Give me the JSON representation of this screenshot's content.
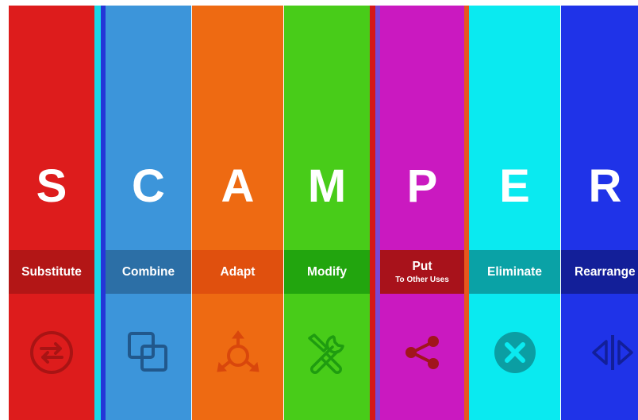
{
  "columns": [
    {
      "letter": "S",
      "word": "Substitute",
      "sub": "",
      "icon": "swap-arrows-icon",
      "bg": "#dd1c1c",
      "band": "#b31616",
      "icon_color": "#a81414"
    },
    {
      "letter": "C",
      "word": "Combine",
      "sub": "",
      "icon": "overlapping-squares-icon",
      "bg": "#3c95da",
      "band": "#2c6fa6",
      "icon_color": "#21588c"
    },
    {
      "letter": "A",
      "word": "Adapt",
      "sub": "",
      "icon": "adapt-arrows-icon",
      "bg": "#ee6a12",
      "band": "#e0500e",
      "icon_color": "#d9470c"
    },
    {
      "letter": "M",
      "word": "Modify",
      "sub": "",
      "icon": "tools-icon",
      "bg": "#48cc19",
      "band": "#22a50e",
      "icon_color": "#1f9c10"
    },
    {
      "letter": "P",
      "word": "Put",
      "sub": "To Other Uses",
      "icon": "share-icon",
      "bg": "#ca19c0",
      "band": "#a8121b",
      "icon_color": "#a1151c"
    },
    {
      "letter": "E",
      "word": "Eliminate",
      "sub": "",
      "icon": "remove-circle-icon",
      "bg": "#0aeaf0",
      "band": "#0aa2a6",
      "icon_color": "#0b9ea3"
    },
    {
      "letter": "R",
      "word": "Rearrange",
      "sub": "",
      "icon": "flip-arrows-icon",
      "bg": "#1f33e8",
      "band": "#131f99",
      "icon_color": "#121f99"
    }
  ]
}
